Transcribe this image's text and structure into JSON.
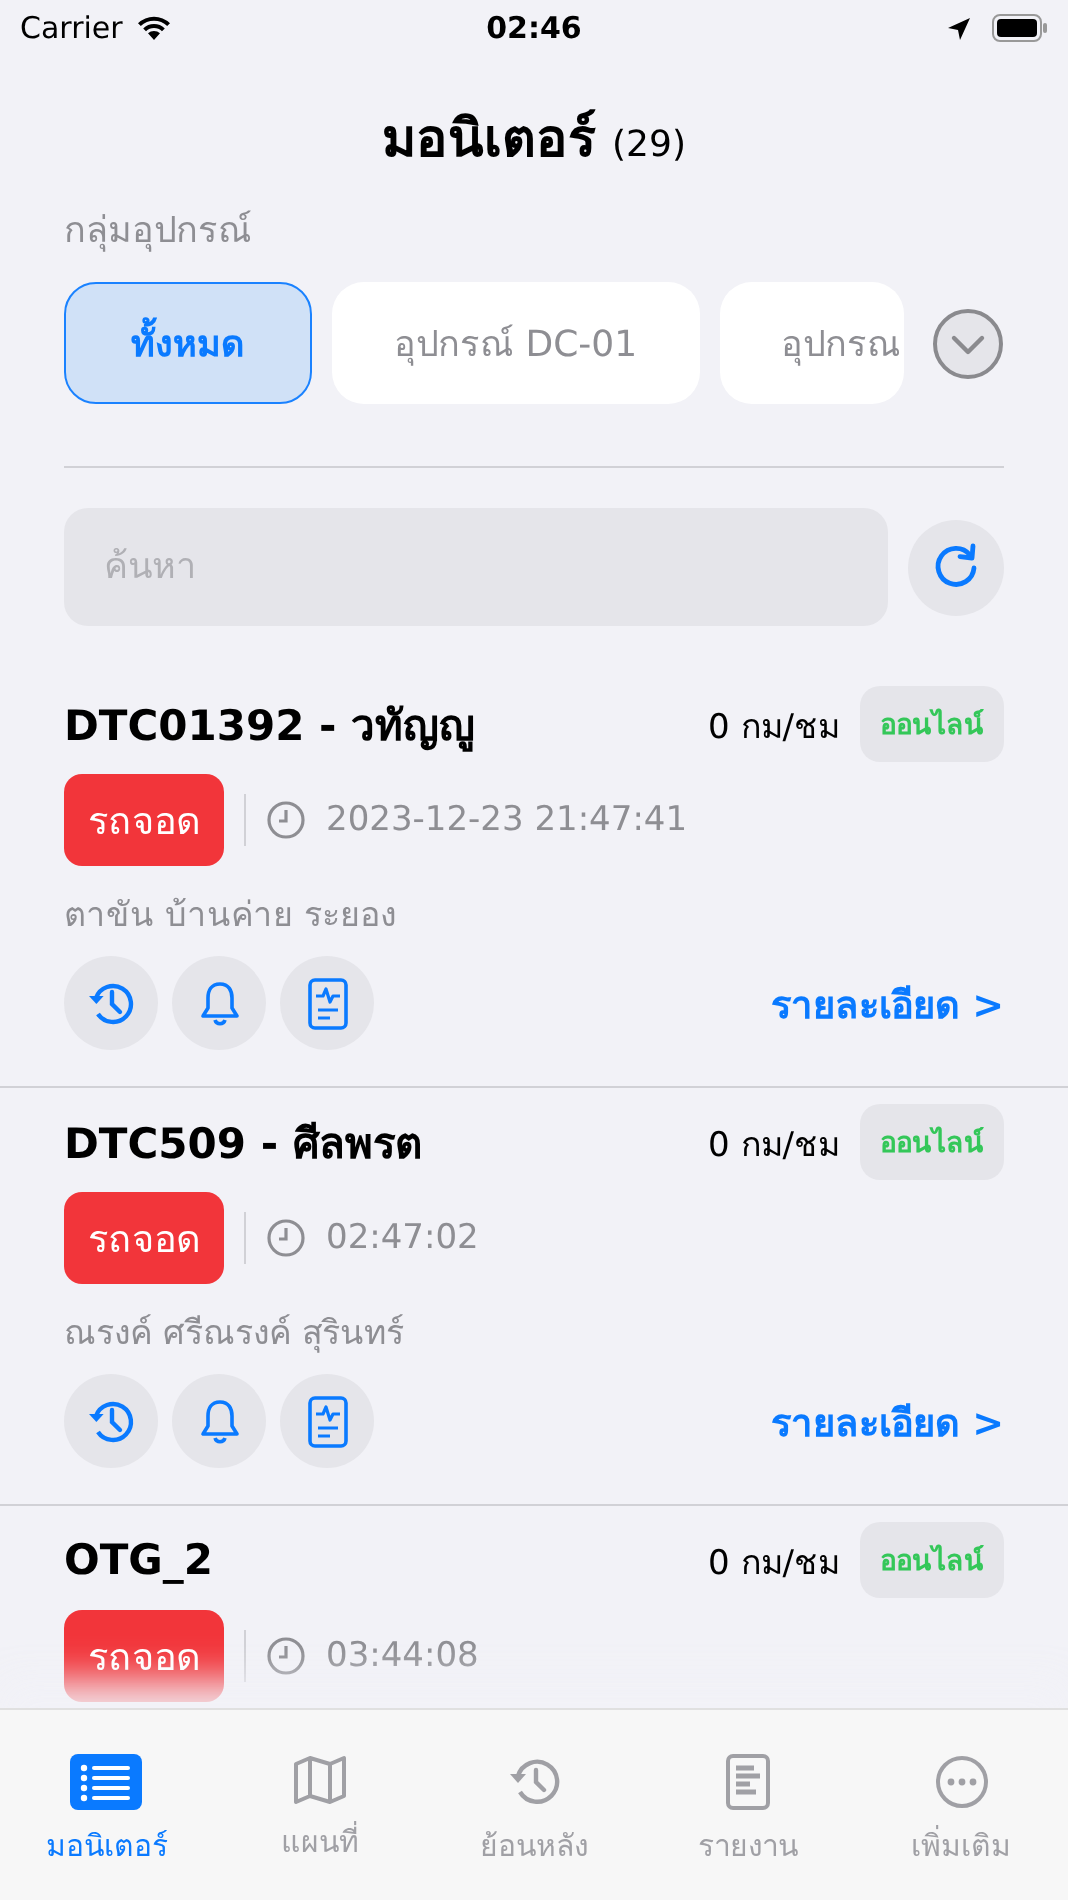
{
  "status_bar": {
    "carrier": "Carrier",
    "time": "02:46"
  },
  "header": {
    "title": "มอนิเตอร์",
    "count": "(29)"
  },
  "group_label": "กลุ่มอุปกรณ์",
  "groups": [
    {
      "label": "ทั้งหมด",
      "selected": true
    },
    {
      "label": "อุปกรณ์ DC-01",
      "selected": false
    },
    {
      "label": "อุปกรณ",
      "selected": false
    }
  ],
  "search": {
    "placeholder": "ค้นหา"
  },
  "vehicles": [
    {
      "title": "DTC01392 - วทัญญู",
      "speed": "0 กม/ชม",
      "connection": "ออนไลน์",
      "online": true,
      "state": "รถจอด",
      "time": "2023-12-23 21:47:41",
      "address": "ตาขัน บ้านค่าย ระยอง",
      "details": "รายละเอียด >"
    },
    {
      "title": "DTC509 - ศีลพรต",
      "speed": "0 กม/ชม",
      "connection": "ออนไลน์",
      "online": true,
      "state": "รถจอด",
      "time": "02:47:02",
      "address": "ณรงค์ ศรีณรงค์ สุรินทร์",
      "details": "รายละเอียด >"
    },
    {
      "title": "OTG_2",
      "speed": "0 กม/ชม",
      "connection": "ออนไลน์",
      "online": true,
      "state": "รถจอด",
      "time": "03:44:08"
    }
  ],
  "tabs": [
    {
      "kind": "list",
      "label": "มอนิเตอร์",
      "selected": true
    },
    {
      "kind": "map",
      "label": "แผนที่",
      "selected": false
    },
    {
      "kind": "history",
      "label": "ย้อนหลัง",
      "selected": false
    },
    {
      "kind": "report",
      "label": "รายงาน",
      "selected": false
    },
    {
      "kind": "more",
      "label": "เพิ่มเติม",
      "selected": false
    }
  ]
}
